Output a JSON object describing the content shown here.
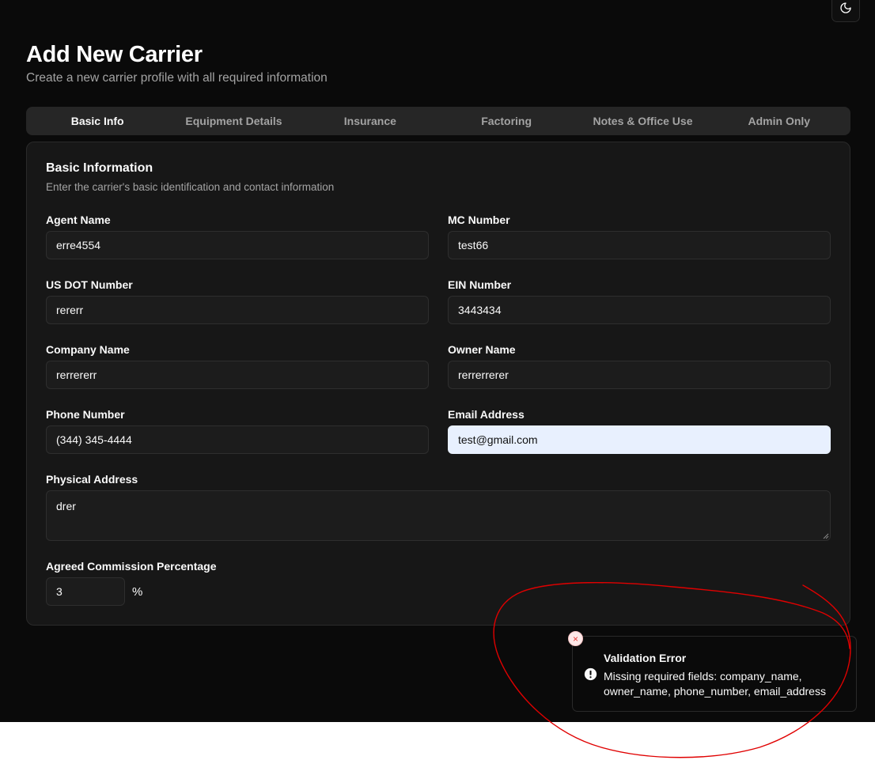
{
  "header": {
    "title": "Add New Carrier",
    "subtitle": "Create a new carrier profile with all required information",
    "theme_toggle_icon": "moon-icon"
  },
  "tabs": [
    {
      "label": "Basic Info",
      "active": true
    },
    {
      "label": "Equipment Details",
      "active": false
    },
    {
      "label": "Insurance",
      "active": false
    },
    {
      "label": "Factoring",
      "active": false
    },
    {
      "label": "Notes & Office Use",
      "active": false
    },
    {
      "label": "Admin Only",
      "active": false
    }
  ],
  "card": {
    "title": "Basic Information",
    "description": "Enter the carrier's basic identification and contact information"
  },
  "fields": {
    "agent_name": {
      "label": "Agent Name",
      "value": "erre4554"
    },
    "mc_number": {
      "label": "MC Number",
      "value": "test66"
    },
    "us_dot_number": {
      "label": "US DOT Number",
      "value": "rererr"
    },
    "ein_number": {
      "label": "EIN Number",
      "value": "3443434"
    },
    "company_name": {
      "label": "Company Name",
      "value": "rerrererr"
    },
    "owner_name": {
      "label": "Owner Name",
      "value": "rerrerrerer"
    },
    "phone_number": {
      "label": "Phone Number",
      "value": "(344) 345-4444"
    },
    "email_address": {
      "label": "Email Address",
      "value": "test@gmail.com"
    },
    "physical_address": {
      "label": "Physical Address",
      "value": "drer"
    },
    "commission": {
      "label": "Agreed Commission Percentage",
      "value": "3",
      "unit": "%"
    }
  },
  "toast": {
    "title": "Validation Error",
    "message": "Missing required fields: company_name, owner_name, phone_number, email_address",
    "close_symbol": "×",
    "icon": "alert-circle-icon"
  },
  "colors": {
    "background": "#0a0a0a",
    "card": "#171717",
    "annotation": "#e00000",
    "autofill": "#e8f0fe",
    "error": "#e53935"
  }
}
